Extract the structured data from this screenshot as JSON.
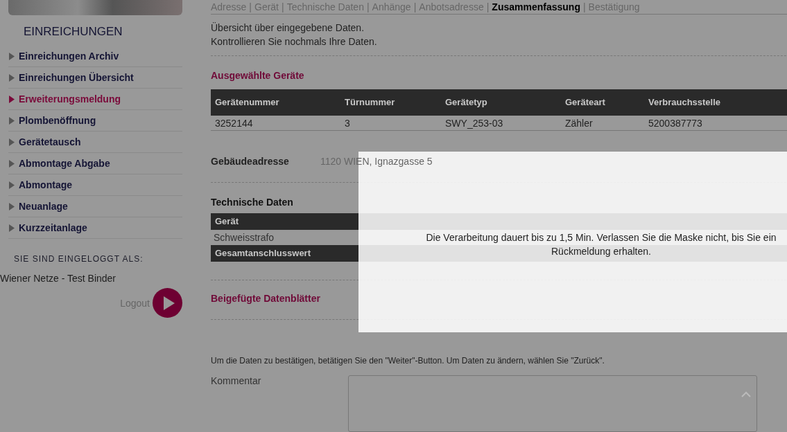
{
  "sidebar": {
    "heading": "EINREICHUNGEN",
    "items": [
      {
        "label": "Einreichungen Archiv",
        "selected": false
      },
      {
        "label": "Einreichungen Übersicht",
        "selected": false
      },
      {
        "label": "Erweiterungsmeldung",
        "selected": true
      },
      {
        "label": "Plombenöffnung",
        "selected": false
      },
      {
        "label": "Gerätetausch",
        "selected": false
      },
      {
        "label": "Abmontage Abgabe",
        "selected": false
      },
      {
        "label": "Abmontage",
        "selected": false
      },
      {
        "label": "Neuanlage",
        "selected": false
      },
      {
        "label": "Kurzzeitanlage",
        "selected": false
      }
    ],
    "login_label": "SIE SIND EINGELOGGT ALS:",
    "user": "Wiener Netze - Test Binder",
    "logout": "Logout"
  },
  "breadcrumb": {
    "separator": "|",
    "steps": [
      {
        "label": "Adresse",
        "selected": false
      },
      {
        "label": "Gerät",
        "selected": false
      },
      {
        "label": "Technische Daten",
        "selected": false
      },
      {
        "label": "Anhänge",
        "selected": false
      },
      {
        "label": "Anbotsadresse",
        "selected": false
      },
      {
        "label": "Zusammenfassung",
        "selected": true
      },
      {
        "label": "Bestätigung",
        "selected": false
      }
    ]
  },
  "intro": [
    "Übersicht über eingegebene Daten.",
    "Kontrollieren Sie nochmals Ihre Daten."
  ],
  "devices": {
    "title": "Ausgewählte Geräte",
    "columns": [
      "Gerätenummer",
      "Türnummer",
      "Gerätetyp",
      "Geräteart",
      "Verbrauchsstelle"
    ],
    "rows": [
      [
        "3252144",
        "3",
        "SWY_253-03",
        "Zähler",
        "5200387773"
      ]
    ]
  },
  "building_address": {
    "label": "Gebäudeadresse",
    "value": "1120 WIEN, Ignazgasse 5"
  },
  "technical": {
    "title": "Technische Daten",
    "columns": [
      "Gerät"
    ],
    "rows": [
      [
        "Schweisstrafo"
      ]
    ],
    "total_label": "Gesamtanschlusswert"
  },
  "attachments": {
    "title": "Beigefügte Datenblätter"
  },
  "instruction": "Um die Daten zu bestätigen, betätigen Sie den \"Weiter\"-Button. Um Daten zu ändern, wählen Sie \"Zurück\".",
  "comment": {
    "label": "Kommentar"
  },
  "modal": {
    "lines": [
      "Die Verarbeitung dauert bis zu 1,5 Min. Verlassen Sie die Maske nicht, bis Sie ein",
      "Rückmeldung erhalten."
    ]
  }
}
